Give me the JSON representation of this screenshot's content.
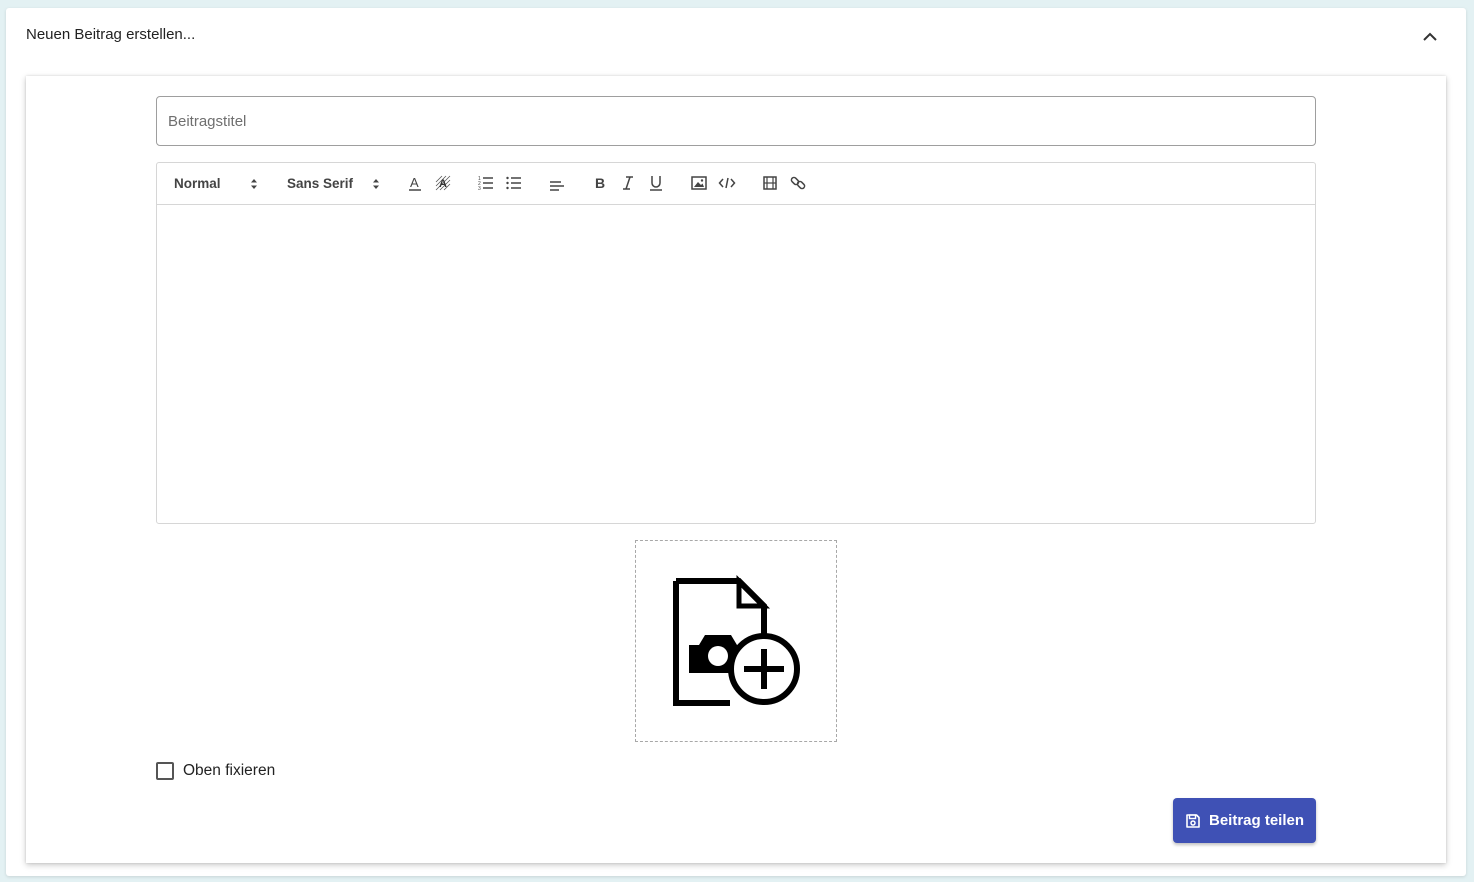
{
  "panel": {
    "title": "Neuen Beitrag erstellen...",
    "collapse_icon": "chevron-up-icon"
  },
  "form": {
    "title_placeholder": "Beitragstitel",
    "title_value": ""
  },
  "editor": {
    "toolbar": {
      "header_select": "Normal",
      "font_select": "Sans Serif",
      "buttons": [
        "text-color",
        "background-color",
        "ordered-list",
        "bullet-list",
        "align",
        "bold",
        "italic",
        "underline",
        "image",
        "code",
        "video",
        "link"
      ]
    },
    "content": ""
  },
  "image_upload": {
    "icon": "add-photo-file-icon"
  },
  "pin_checkbox": {
    "label": "Oben fixieren",
    "checked": false
  },
  "submit": {
    "label": "Beitrag teilen",
    "icon": "save-icon",
    "color": "#3f51b5"
  }
}
